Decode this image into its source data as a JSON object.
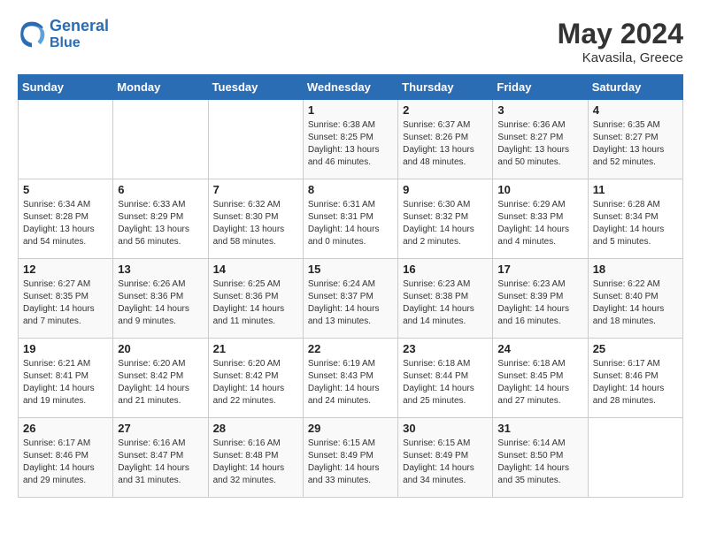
{
  "header": {
    "logo_general": "General",
    "logo_blue": "Blue",
    "month_year": "May 2024",
    "location": "Kavasila, Greece"
  },
  "weekdays": [
    "Sunday",
    "Monday",
    "Tuesday",
    "Wednesday",
    "Thursday",
    "Friday",
    "Saturday"
  ],
  "weeks": [
    [
      {
        "day": "",
        "sunrise": "",
        "sunset": "",
        "daylight": ""
      },
      {
        "day": "",
        "sunrise": "",
        "sunset": "",
        "daylight": ""
      },
      {
        "day": "",
        "sunrise": "",
        "sunset": "",
        "daylight": ""
      },
      {
        "day": "1",
        "sunrise": "Sunrise: 6:38 AM",
        "sunset": "Sunset: 8:25 PM",
        "daylight": "Daylight: 13 hours and 46 minutes."
      },
      {
        "day": "2",
        "sunrise": "Sunrise: 6:37 AM",
        "sunset": "Sunset: 8:26 PM",
        "daylight": "Daylight: 13 hours and 48 minutes."
      },
      {
        "day": "3",
        "sunrise": "Sunrise: 6:36 AM",
        "sunset": "Sunset: 8:27 PM",
        "daylight": "Daylight: 13 hours and 50 minutes."
      },
      {
        "day": "4",
        "sunrise": "Sunrise: 6:35 AM",
        "sunset": "Sunset: 8:27 PM",
        "daylight": "Daylight: 13 hours and 52 minutes."
      }
    ],
    [
      {
        "day": "5",
        "sunrise": "Sunrise: 6:34 AM",
        "sunset": "Sunset: 8:28 PM",
        "daylight": "Daylight: 13 hours and 54 minutes."
      },
      {
        "day": "6",
        "sunrise": "Sunrise: 6:33 AM",
        "sunset": "Sunset: 8:29 PM",
        "daylight": "Daylight: 13 hours and 56 minutes."
      },
      {
        "day": "7",
        "sunrise": "Sunrise: 6:32 AM",
        "sunset": "Sunset: 8:30 PM",
        "daylight": "Daylight: 13 hours and 58 minutes."
      },
      {
        "day": "8",
        "sunrise": "Sunrise: 6:31 AM",
        "sunset": "Sunset: 8:31 PM",
        "daylight": "Daylight: 14 hours and 0 minutes."
      },
      {
        "day": "9",
        "sunrise": "Sunrise: 6:30 AM",
        "sunset": "Sunset: 8:32 PM",
        "daylight": "Daylight: 14 hours and 2 minutes."
      },
      {
        "day": "10",
        "sunrise": "Sunrise: 6:29 AM",
        "sunset": "Sunset: 8:33 PM",
        "daylight": "Daylight: 14 hours and 4 minutes."
      },
      {
        "day": "11",
        "sunrise": "Sunrise: 6:28 AM",
        "sunset": "Sunset: 8:34 PM",
        "daylight": "Daylight: 14 hours and 5 minutes."
      }
    ],
    [
      {
        "day": "12",
        "sunrise": "Sunrise: 6:27 AM",
        "sunset": "Sunset: 8:35 PM",
        "daylight": "Daylight: 14 hours and 7 minutes."
      },
      {
        "day": "13",
        "sunrise": "Sunrise: 6:26 AM",
        "sunset": "Sunset: 8:36 PM",
        "daylight": "Daylight: 14 hours and 9 minutes."
      },
      {
        "day": "14",
        "sunrise": "Sunrise: 6:25 AM",
        "sunset": "Sunset: 8:36 PM",
        "daylight": "Daylight: 14 hours and 11 minutes."
      },
      {
        "day": "15",
        "sunrise": "Sunrise: 6:24 AM",
        "sunset": "Sunset: 8:37 PM",
        "daylight": "Daylight: 14 hours and 13 minutes."
      },
      {
        "day": "16",
        "sunrise": "Sunrise: 6:23 AM",
        "sunset": "Sunset: 8:38 PM",
        "daylight": "Daylight: 14 hours and 14 minutes."
      },
      {
        "day": "17",
        "sunrise": "Sunrise: 6:23 AM",
        "sunset": "Sunset: 8:39 PM",
        "daylight": "Daylight: 14 hours and 16 minutes."
      },
      {
        "day": "18",
        "sunrise": "Sunrise: 6:22 AM",
        "sunset": "Sunset: 8:40 PM",
        "daylight": "Daylight: 14 hours and 18 minutes."
      }
    ],
    [
      {
        "day": "19",
        "sunrise": "Sunrise: 6:21 AM",
        "sunset": "Sunset: 8:41 PM",
        "daylight": "Daylight: 14 hours and 19 minutes."
      },
      {
        "day": "20",
        "sunrise": "Sunrise: 6:20 AM",
        "sunset": "Sunset: 8:42 PM",
        "daylight": "Daylight: 14 hours and 21 minutes."
      },
      {
        "day": "21",
        "sunrise": "Sunrise: 6:20 AM",
        "sunset": "Sunset: 8:42 PM",
        "daylight": "Daylight: 14 hours and 22 minutes."
      },
      {
        "day": "22",
        "sunrise": "Sunrise: 6:19 AM",
        "sunset": "Sunset: 8:43 PM",
        "daylight": "Daylight: 14 hours and 24 minutes."
      },
      {
        "day": "23",
        "sunrise": "Sunrise: 6:18 AM",
        "sunset": "Sunset: 8:44 PM",
        "daylight": "Daylight: 14 hours and 25 minutes."
      },
      {
        "day": "24",
        "sunrise": "Sunrise: 6:18 AM",
        "sunset": "Sunset: 8:45 PM",
        "daylight": "Daylight: 14 hours and 27 minutes."
      },
      {
        "day": "25",
        "sunrise": "Sunrise: 6:17 AM",
        "sunset": "Sunset: 8:46 PM",
        "daylight": "Daylight: 14 hours and 28 minutes."
      }
    ],
    [
      {
        "day": "26",
        "sunrise": "Sunrise: 6:17 AM",
        "sunset": "Sunset: 8:46 PM",
        "daylight": "Daylight: 14 hours and 29 minutes."
      },
      {
        "day": "27",
        "sunrise": "Sunrise: 6:16 AM",
        "sunset": "Sunset: 8:47 PM",
        "daylight": "Daylight: 14 hours and 31 minutes."
      },
      {
        "day": "28",
        "sunrise": "Sunrise: 6:16 AM",
        "sunset": "Sunset: 8:48 PM",
        "daylight": "Daylight: 14 hours and 32 minutes."
      },
      {
        "day": "29",
        "sunrise": "Sunrise: 6:15 AM",
        "sunset": "Sunset: 8:49 PM",
        "daylight": "Daylight: 14 hours and 33 minutes."
      },
      {
        "day": "30",
        "sunrise": "Sunrise: 6:15 AM",
        "sunset": "Sunset: 8:49 PM",
        "daylight": "Daylight: 14 hours and 34 minutes."
      },
      {
        "day": "31",
        "sunrise": "Sunrise: 6:14 AM",
        "sunset": "Sunset: 8:50 PM",
        "daylight": "Daylight: 14 hours and 35 minutes."
      },
      {
        "day": "",
        "sunrise": "",
        "sunset": "",
        "daylight": ""
      }
    ]
  ]
}
